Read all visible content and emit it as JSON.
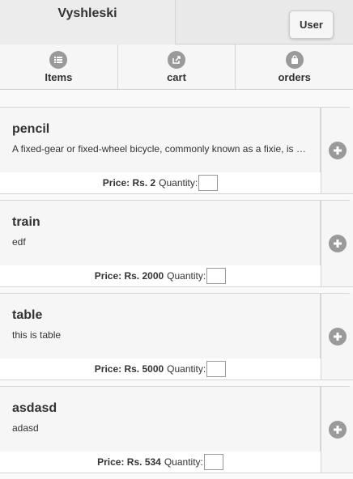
{
  "header": {
    "title": "Vyshleski",
    "user_button": "User"
  },
  "nav": {
    "items": [
      {
        "label": "Items",
        "icon": "list-icon"
      },
      {
        "label": "cart",
        "icon": "share-icon"
      },
      {
        "label": "orders",
        "icon": "bag-icon"
      }
    ]
  },
  "products": [
    {
      "name": "pencil",
      "description": "A fixed-gear or fixed-wheel bicycle, commonly known as a fixie, is a bicycle that has a drivetrain with no freewheel mechanism.",
      "price_label": "Price: Rs. 2",
      "quantity_label": "Quantity:",
      "quantity_value": ""
    },
    {
      "name": "train",
      "description": "edf",
      "price_label": "Price: Rs. 2000",
      "quantity_label": "Quantity:",
      "quantity_value": ""
    },
    {
      "name": "table",
      "description": "this is table",
      "price_label": "Price: Rs. 5000",
      "quantity_label": "Quantity:",
      "quantity_value": ""
    },
    {
      "name": "asdasd",
      "description": "adasd",
      "price_label": "Price: Rs. 534",
      "quantity_label": "Quantity:",
      "quantity_value": ""
    }
  ],
  "colors": {
    "icon_bg": "#9a9a9a",
    "header_bg": "#e9e9e9",
    "footer_bg": "#ffffff"
  }
}
